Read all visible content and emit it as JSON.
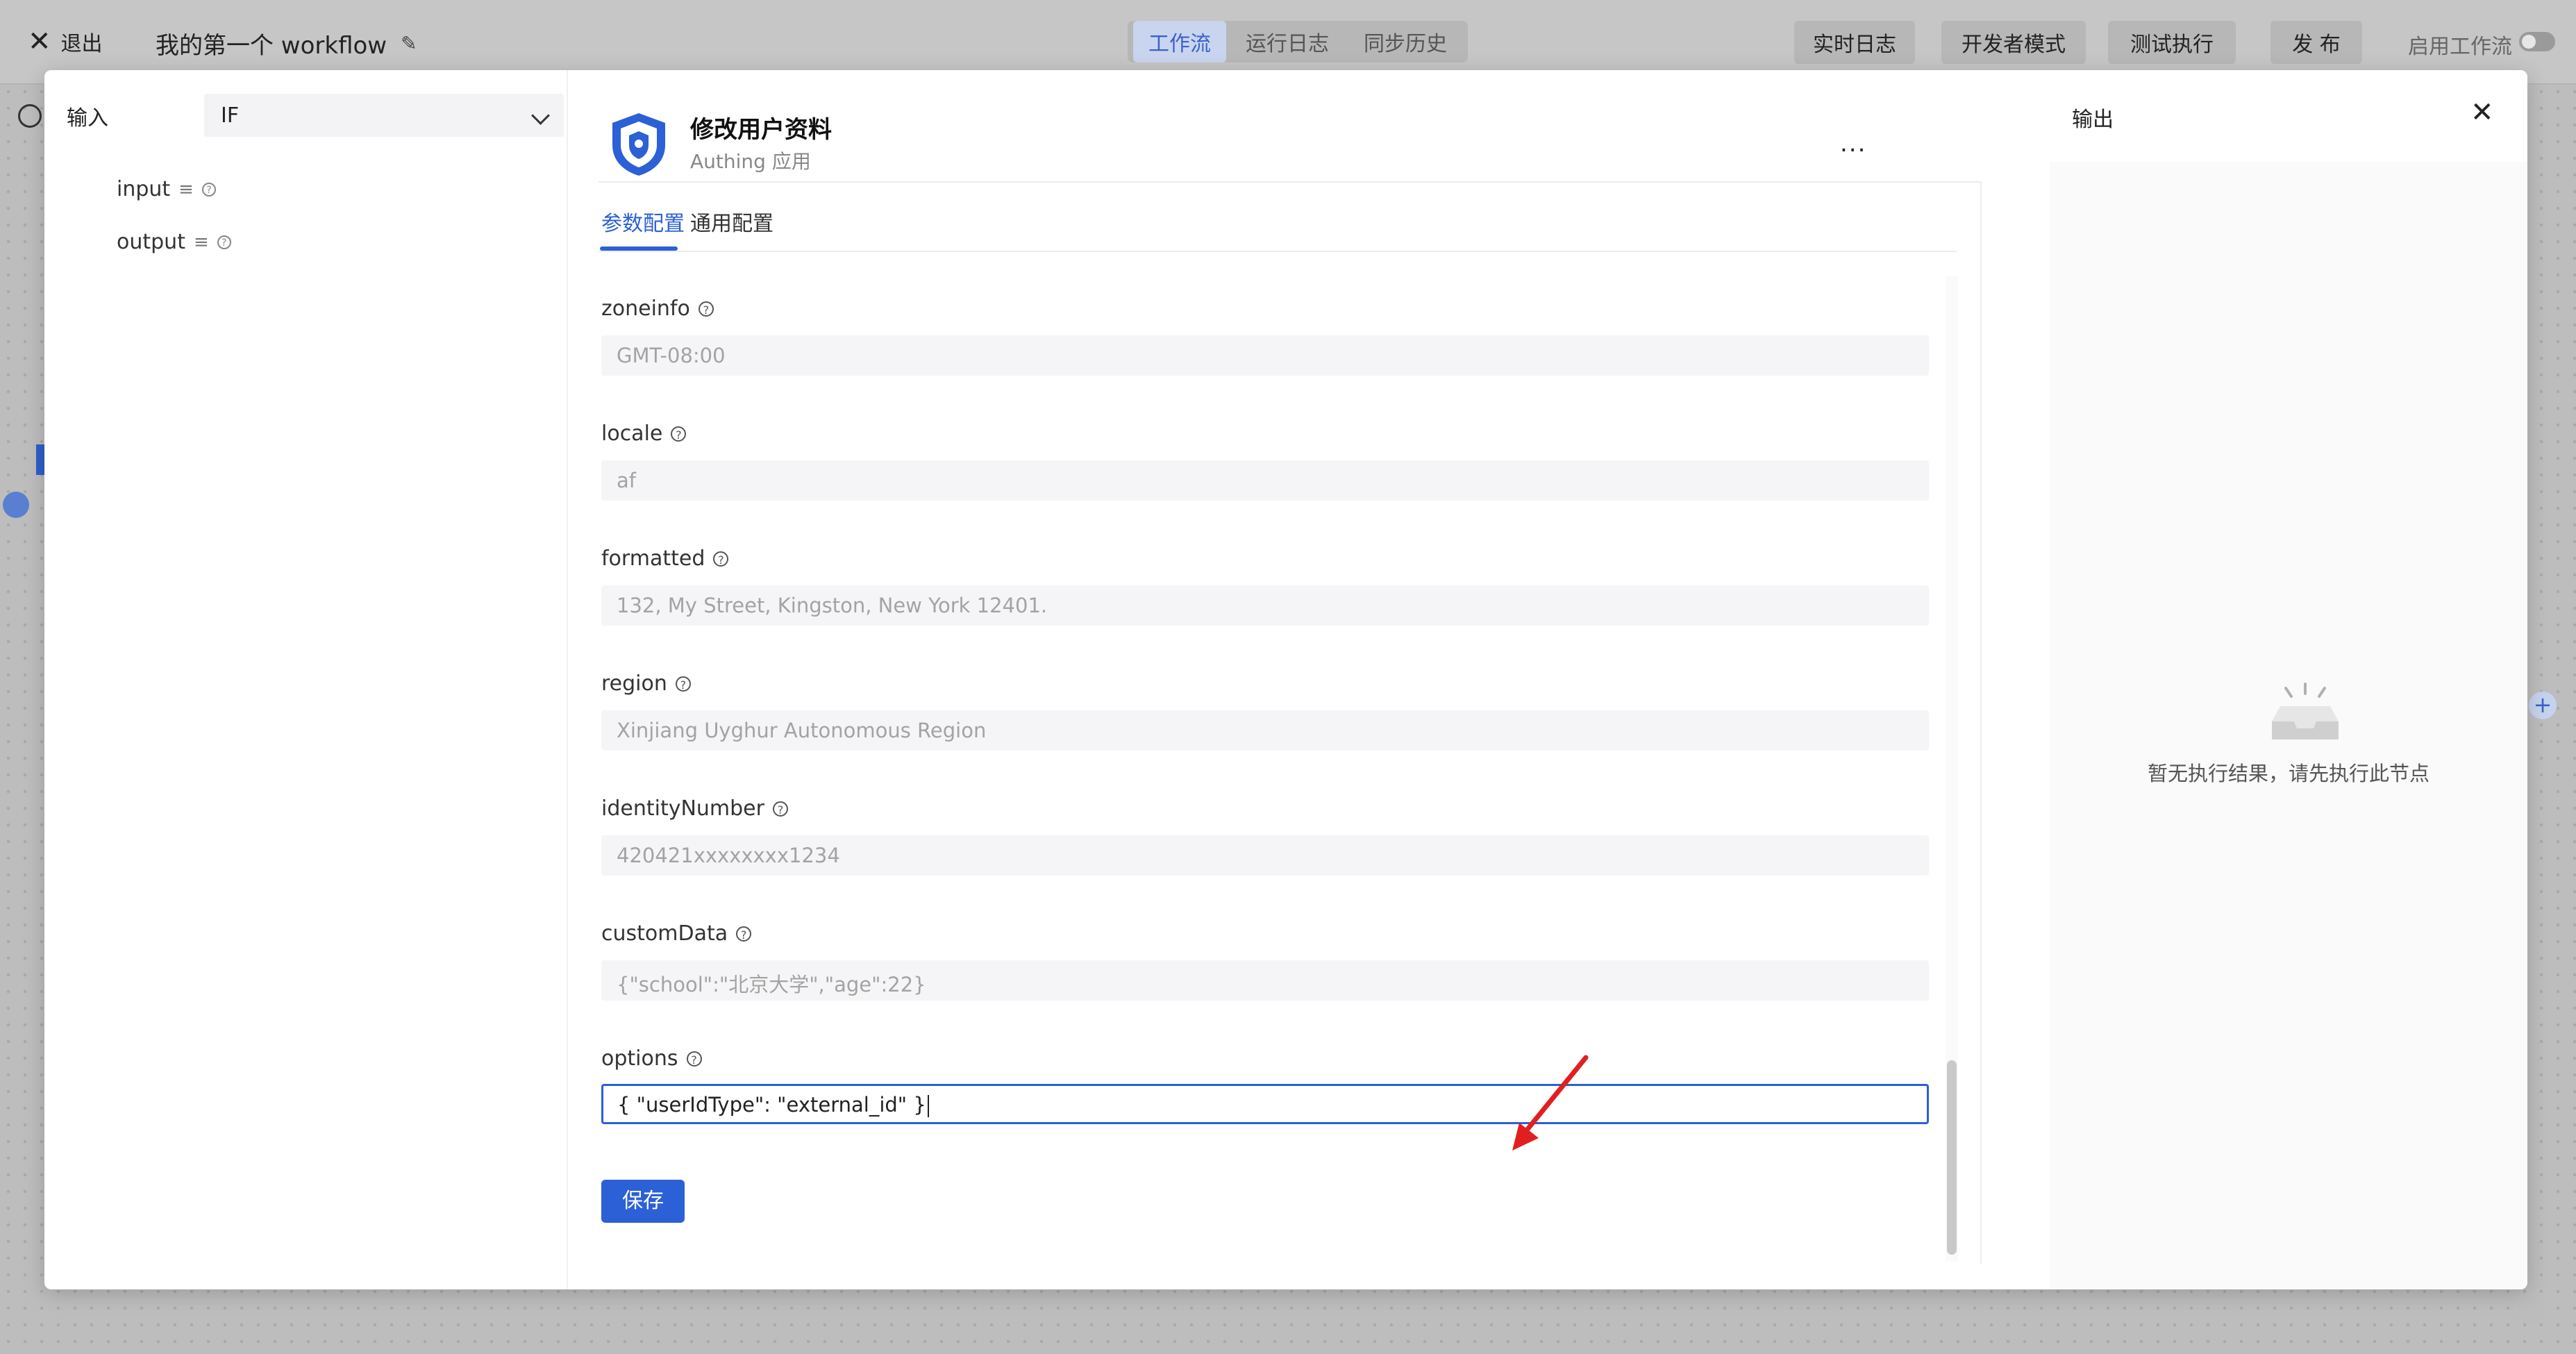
{
  "topbar": {
    "exit_label": "退出",
    "workflow_title": "我的第一个 workflow",
    "tabs": [
      {
        "label": "工作流",
        "active": true
      },
      {
        "label": "运行日志",
        "active": false
      },
      {
        "label": "同步历史",
        "active": false
      }
    ],
    "buttons": {
      "realtime_log": "实时日志",
      "developer_mode": "开发者模式",
      "test_run": "测试执行",
      "publish": "发 布"
    },
    "enable_workflow_label": "启用工作流",
    "enable_workflow_on": false
  },
  "input_pane": {
    "label": "输入",
    "selected_node": "IF",
    "items": [
      "input",
      "output"
    ]
  },
  "config_pane": {
    "app_title": "修改用户资料",
    "app_subtitle": "Authing 应用",
    "more_label": "...",
    "tabs": [
      {
        "label": "参数配置",
        "active": true
      },
      {
        "label": "通用配置",
        "active": false
      }
    ],
    "fields": [
      {
        "label": "zoneinfo",
        "placeholder": "GMT-08:00",
        "value": ""
      },
      {
        "label": "locale",
        "placeholder": "af",
        "value": ""
      },
      {
        "label": "formatted",
        "placeholder": "132, My Street, Kingston, New York 12401.",
        "value": ""
      },
      {
        "label": "region",
        "placeholder": "Xinjiang Uyghur Autonomous Region",
        "value": ""
      },
      {
        "label": "identityNumber",
        "placeholder": "420421xxxxxxxx1234",
        "value": ""
      },
      {
        "label": "customData",
        "placeholder": "{\"school\":\"北京大学\",\"age\":22}",
        "value": ""
      },
      {
        "label": "options",
        "placeholder": "",
        "value": "{ \"userIdType\": \"external_id\" }"
      }
    ],
    "save_label": "保存",
    "accent_color": "#2b60d6"
  },
  "output_pane": {
    "title": "输出",
    "empty_text": "暂无执行结果，请先执行此节点"
  },
  "annotation": {
    "arrow_color": "#e02020"
  }
}
